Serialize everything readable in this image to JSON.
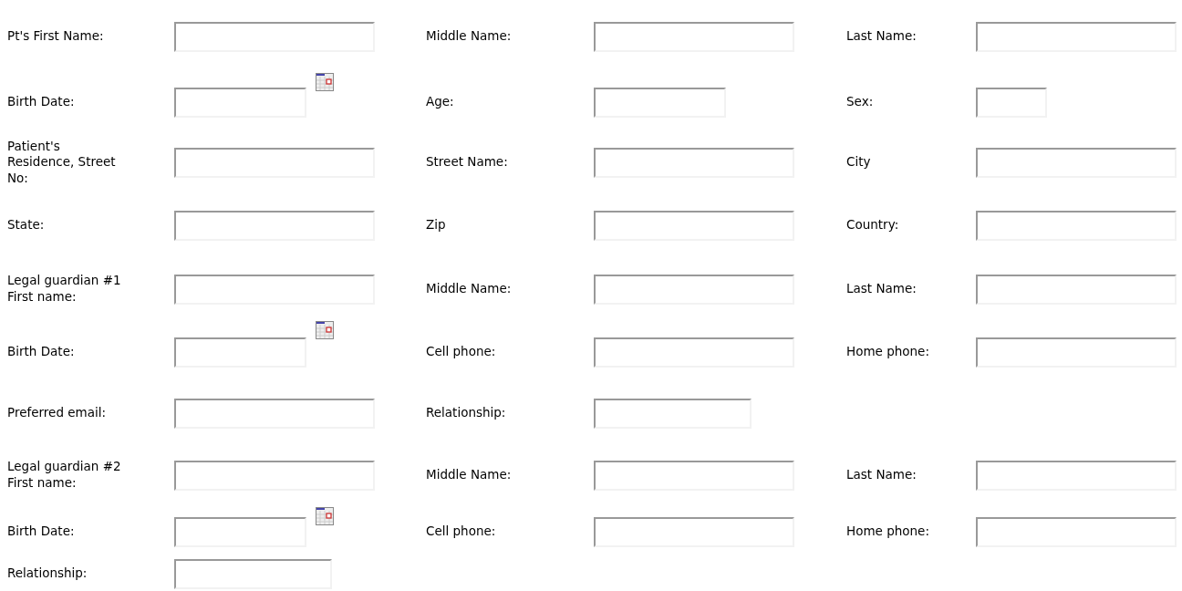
{
  "rows": [
    {
      "fields": [
        {
          "label": "Pt's First Name:",
          "kind": "text"
        },
        {
          "label": "Middle Name:",
          "kind": "text"
        },
        {
          "label": "Last Name:",
          "kind": "text"
        }
      ]
    },
    {
      "fields": [
        {
          "label": "Birth Date:",
          "kind": "date"
        },
        {
          "label": "Age:",
          "kind": "medium"
        },
        {
          "label": "Sex:",
          "kind": "small"
        }
      ]
    },
    {
      "fields": [
        {
          "label": "Patient's\nResidence, Street\nNo:",
          "kind": "text"
        },
        {
          "label": "Street Name:",
          "kind": "text"
        },
        {
          "label": "City",
          "kind": "text"
        }
      ]
    },
    {
      "fields": [
        {
          "label": "State:",
          "kind": "text"
        },
        {
          "label": "Zip",
          "kind": "text"
        },
        {
          "label": "Country:",
          "kind": "text"
        }
      ]
    },
    {
      "fields": [
        {
          "label": "Legal guardian #1\nFirst name:",
          "kind": "text"
        },
        {
          "label": "Middle Name:",
          "kind": "text"
        },
        {
          "label": "Last Name:",
          "kind": "text"
        }
      ]
    },
    {
      "fields": [
        {
          "label": "Birth Date:",
          "kind": "date"
        },
        {
          "label": "Cell phone:",
          "kind": "text"
        },
        {
          "label": "Home phone:",
          "kind": "text"
        }
      ]
    },
    {
      "fields": [
        {
          "label": "Preferred email:",
          "kind": "text"
        },
        {
          "label": "Relationship:",
          "kind": "wide"
        }
      ]
    },
    {
      "fields": [
        {
          "label": "Legal guardian #2\nFirst name:",
          "kind": "text"
        },
        {
          "label": "Middle Name:",
          "kind": "text"
        },
        {
          "label": "Last Name:",
          "kind": "text"
        }
      ]
    },
    {
      "fields": [
        {
          "label": "Birth Date:",
          "kind": "date"
        },
        {
          "label": "Cell phone:",
          "kind": "text"
        },
        {
          "label": "Home phone:",
          "kind": "text"
        }
      ]
    },
    {
      "fields": [
        {
          "label": "Relationship:",
          "kind": "wide"
        }
      ]
    }
  ]
}
